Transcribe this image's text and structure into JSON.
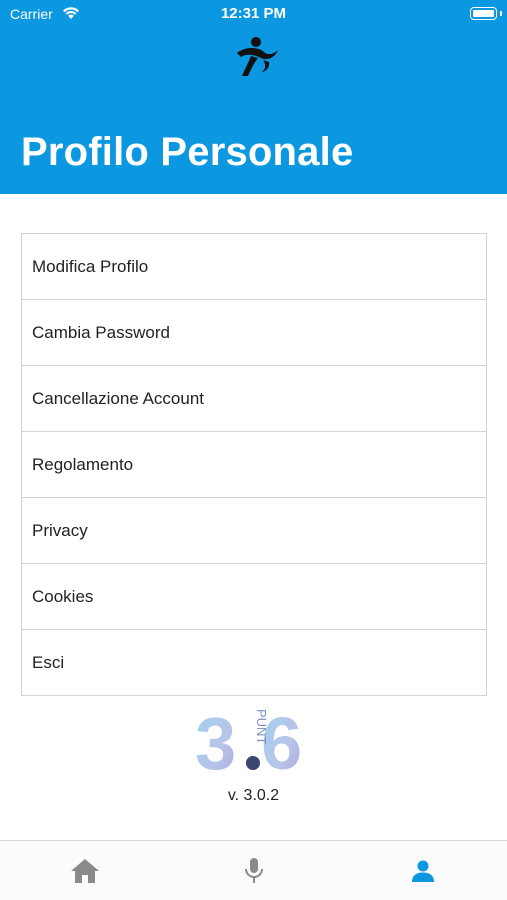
{
  "status_bar": {
    "carrier": "Carrier",
    "time": "12:31 PM"
  },
  "header": {
    "title": "Profilo Personale",
    "background_color": "#0b98e0"
  },
  "menu": {
    "items": [
      {
        "label": "Modifica Profilo"
      },
      {
        "label": "Cambia Password"
      },
      {
        "label": "Cancellazione Account"
      },
      {
        "label": "Regolamento"
      },
      {
        "label": "Privacy"
      },
      {
        "label": "Cookies"
      },
      {
        "label": "Esci"
      }
    ]
  },
  "footer": {
    "logo_text": "3.6",
    "logo_subtext": "PUNT",
    "version": "v. 3.0.2"
  },
  "tabbar": {
    "tabs": [
      {
        "icon": "home-icon",
        "active": false
      },
      {
        "icon": "microphone-icon",
        "active": false
      },
      {
        "icon": "person-icon",
        "active": true
      }
    ],
    "active_color": "#0b98e0",
    "inactive_color": "#8a8a8a"
  }
}
